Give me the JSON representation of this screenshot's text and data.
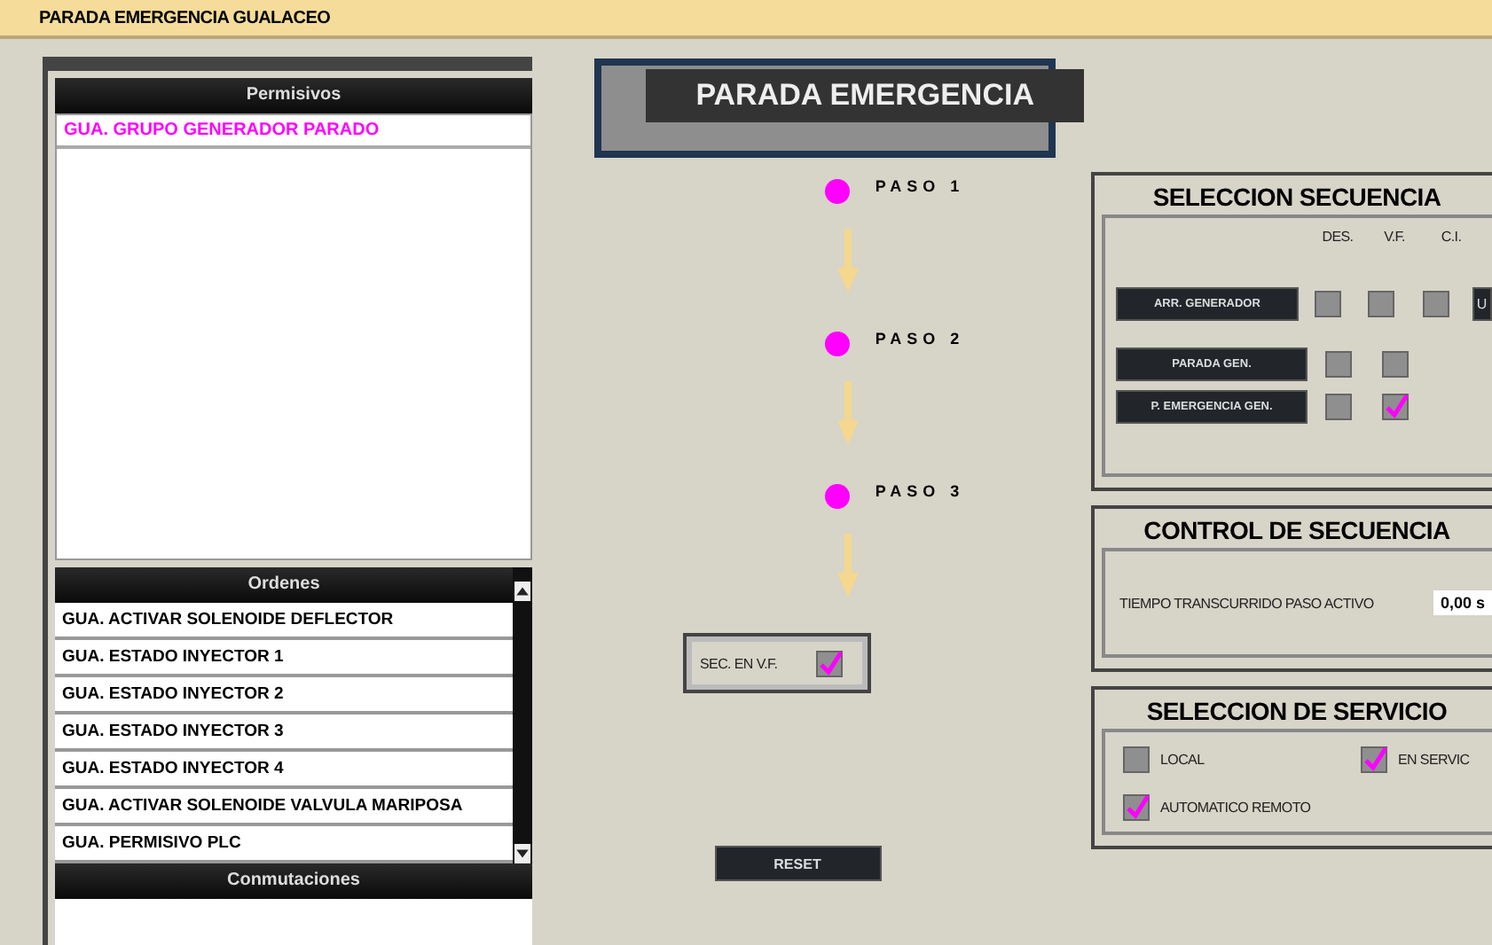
{
  "window": {
    "title": "PARADA EMERGENCIA GUALACEO"
  },
  "permisivos": {
    "title": "Permisivos",
    "items": [
      {
        "text": "GUA. GRUPO GENERADOR PARADO",
        "active": true
      }
    ]
  },
  "ordenes": {
    "title": "Ordenes",
    "items": [
      "GUA.  ACTIVAR SOLENOIDE  DEFLECTOR",
      "GUA. ESTADO INYECTOR 1",
      "GUA. ESTADO INYECTOR 2",
      "GUA. ESTADO INYECTOR 3",
      "GUA. ESTADO INYECTOR 4",
      "GUA. ACTIVAR SOLENOIDE VALVULA MARIPOSA",
      "GUA. PERMISIVO PLC"
    ]
  },
  "conmutaciones": {
    "title": "Conmutaciones"
  },
  "sequence": {
    "title": "PARADA EMERGENCIA",
    "steps": [
      {
        "label": "PASO 1",
        "color": "#ff00ff"
      },
      {
        "label": "PASO 2",
        "color": "#ff00ff"
      },
      {
        "label": "PASO 3",
        "color": "#ff00ff"
      }
    ],
    "vf_label": "SEC. EN V.F.",
    "vf_checked": true,
    "reset": "RESET"
  },
  "seleccion_secuencia": {
    "title": "SELECCION SECUENCIA",
    "columns": [
      "DES.",
      "V.F.",
      "C.I."
    ],
    "rows": [
      {
        "label": "ARR. GENERADOR",
        "cells": [
          {
            "checked": false
          },
          {
            "checked": false
          },
          {
            "checked": false
          }
        ],
        "extra": "U"
      },
      {
        "label": "PARADA GEN.",
        "cells": [
          {
            "checked": false
          },
          {
            "checked": false
          }
        ]
      },
      {
        "label": "P. EMERGENCIA GEN.",
        "cells": [
          {
            "checked": false
          },
          {
            "checked": true
          }
        ]
      }
    ]
  },
  "control_secuencia": {
    "title": "CONTROL DE SECUENCIA",
    "label": "TIEMPO TRANSCURRIDO PASO ACTIVO",
    "value": "0,00 s"
  },
  "seleccion_servicio": {
    "title": "SELECCION DE SERVICIO",
    "options": [
      {
        "label": "LOCAL",
        "checked": false
      },
      {
        "label": "EN SERVIC",
        "checked": true
      },
      {
        "label": "AUTOMATICO REMOTO",
        "checked": true
      }
    ]
  }
}
